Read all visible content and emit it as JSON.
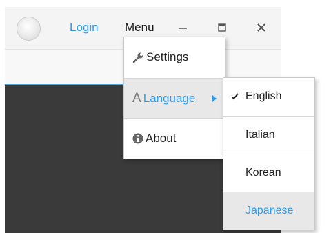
{
  "titlebar": {
    "login_label": "Login",
    "menu_label": "Menu",
    "icons": [
      "avatar",
      "minimize-icon",
      "maximize-icon",
      "close-icon"
    ]
  },
  "menu": {
    "items": [
      {
        "label": "Settings",
        "icon": "wrench-icon"
      },
      {
        "label": "Language",
        "icon": "language-a-icon",
        "icon_glyph": "A",
        "has_submenu": true,
        "state": "hover"
      },
      {
        "label": "About",
        "icon": "info-icon"
      }
    ]
  },
  "language_submenu": {
    "items": [
      {
        "label": "English",
        "checked": true
      },
      {
        "label": "Italian",
        "checked": false
      },
      {
        "label": "Korean",
        "checked": false
      },
      {
        "label": "Japanese",
        "checked": false,
        "state": "hover"
      }
    ]
  },
  "colors": {
    "accent": "#2a9df4",
    "dark_panel": "#3a3a3a",
    "hover_bg": "#e8e8e8"
  }
}
